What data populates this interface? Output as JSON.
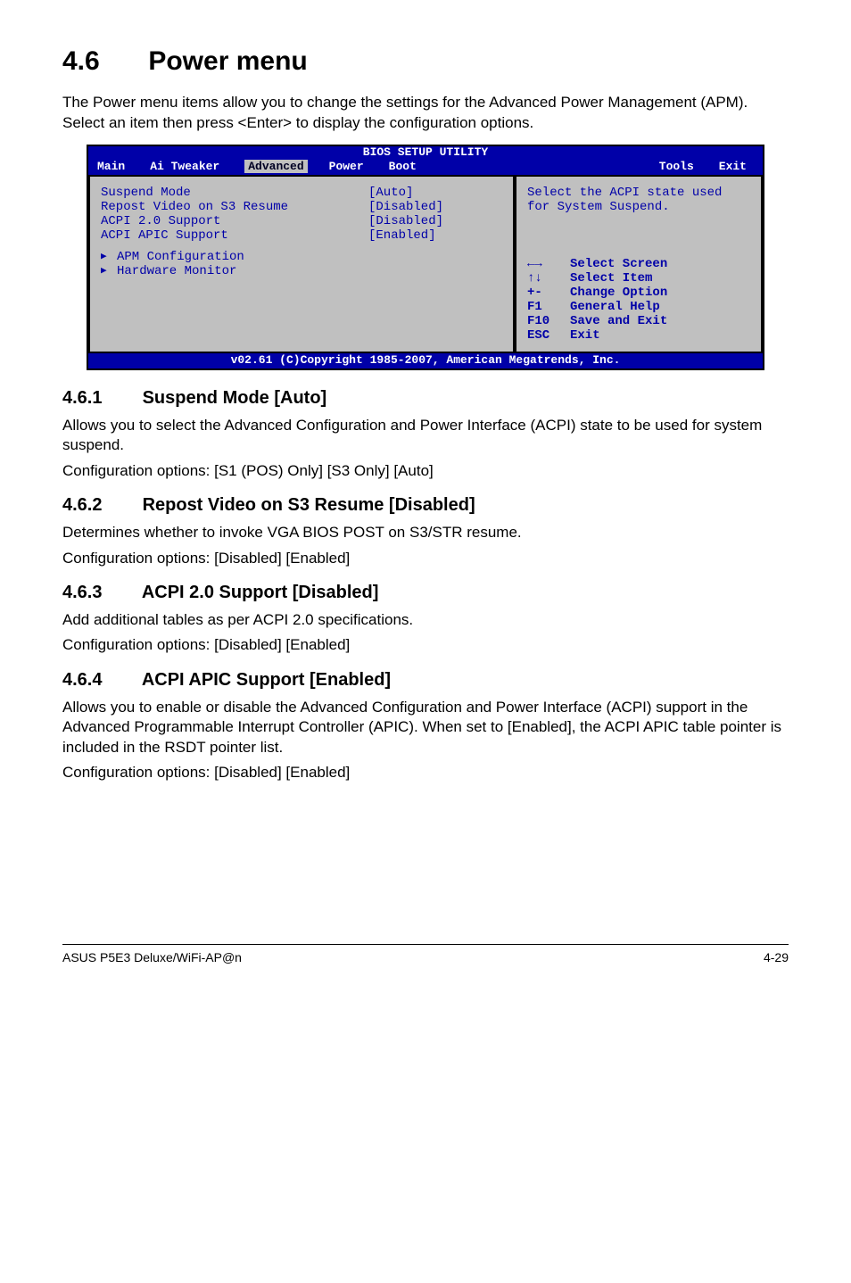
{
  "heading": {
    "num": "4.6",
    "title": "Power menu"
  },
  "intro": "The Power menu items allow you to change the settings for the Advanced Power Management (APM). Select an item then press <Enter> to display the configuration options.",
  "bios": {
    "title": "BIOS SETUP UTILITY",
    "menu": [
      "Main",
      "Ai Tweaker",
      "Advanced",
      "Power",
      "Boot",
      "Tools",
      "Exit"
    ],
    "active_menu": "Advanced",
    "items": [
      {
        "label": "Suspend Mode",
        "value": "[Auto]"
      },
      {
        "label": "Repost Video on S3 Resume",
        "value": "[Disabled]"
      },
      {
        "label": "ACPI 2.0 Support",
        "value": "[Disabled]"
      },
      {
        "label": "ACPI APIC Support",
        "value": "[Enabled]"
      }
    ],
    "subitems": [
      "APM Configuration",
      "Hardware Monitor"
    ],
    "help": "Select the ACPI state used for System Suspend.",
    "keys": [
      {
        "sym": "←→",
        "desc": "Select Screen"
      },
      {
        "sym": "↑↓",
        "desc": "Select Item"
      },
      {
        "sym": "+-",
        "desc": "Change Option"
      },
      {
        "sym": "F1",
        "desc": "General Help"
      },
      {
        "sym": "F10",
        "desc": "Save and Exit"
      },
      {
        "sym": "ESC",
        "desc": "Exit"
      }
    ],
    "footer": "v02.61 (C)Copyright 1985-2007, American Megatrends, Inc."
  },
  "sections": [
    {
      "num": "4.6.1",
      "title": "Suspend Mode [Auto]",
      "paras": [
        "Allows you to select the Advanced Configuration and Power Interface (ACPI) state to be used for system suspend.",
        "Configuration options: [S1 (POS) Only] [S3 Only] [Auto]"
      ]
    },
    {
      "num": "4.6.2",
      "title": "Repost Video on S3 Resume [Disabled]",
      "paras": [
        "Determines whether to invoke VGA BIOS POST on S3/STR resume.",
        "Configuration options: [Disabled] [Enabled]"
      ]
    },
    {
      "num": "4.6.3",
      "title": "ACPI 2.0 Support [Disabled]",
      "paras": [
        "Add additional tables as per ACPI 2.0 specifications.",
        "Configuration options: [Disabled] [Enabled]"
      ]
    },
    {
      "num": "4.6.4",
      "title": "ACPI APIC Support [Enabled]",
      "paras": [
        "Allows you to enable or disable the Advanced Configuration and Power Interface (ACPI) support in the Advanced Programmable Interrupt Controller (APIC). When set to [Enabled], the ACPI APIC table pointer is included in the RSDT pointer list.",
        "Configuration options: [Disabled] [Enabled]"
      ]
    }
  ],
  "footer": {
    "left": "ASUS P5E3 Deluxe/WiFi-AP@n",
    "right": "4-29"
  }
}
